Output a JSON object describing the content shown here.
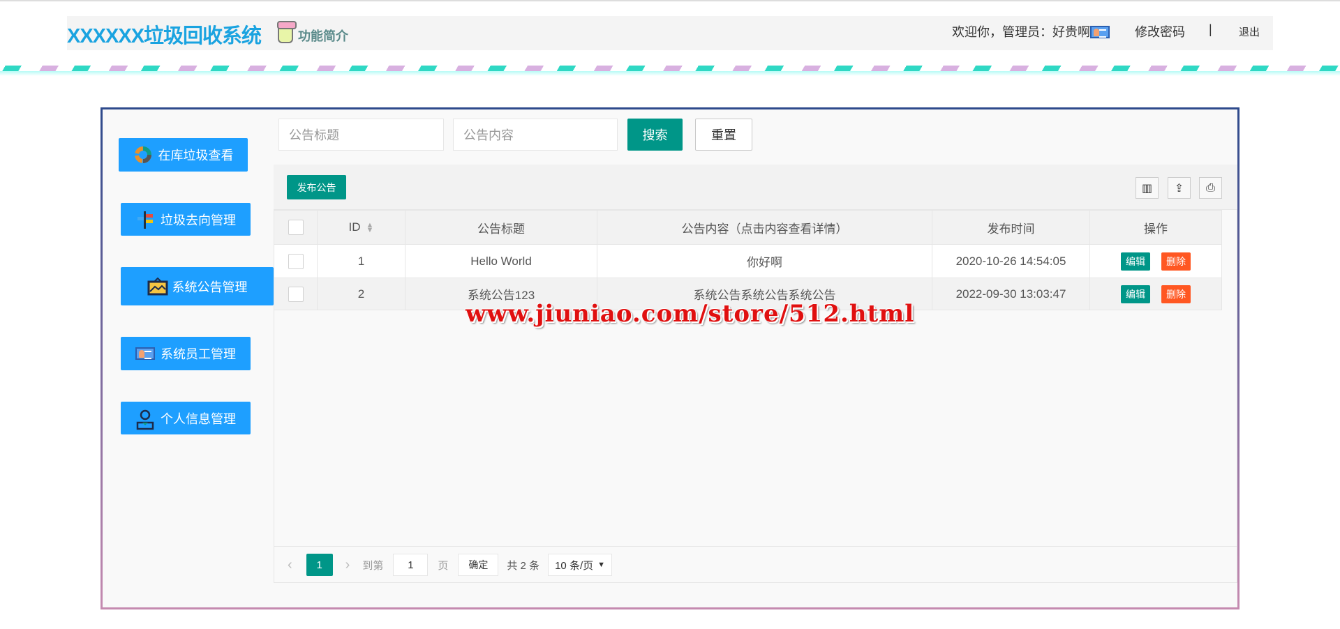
{
  "header": {
    "title": "XXXXXX垃圾回收系统",
    "intro": "功能简介",
    "welcome": "欢迎你，管理员：好贵啊",
    "change_password": "修改密码",
    "separator": "|",
    "logout": "退出"
  },
  "sidebar": {
    "items": [
      {
        "label": "在库垃圾查看",
        "icon": "recycle-icon"
      },
      {
        "label": "垃圾去向管理",
        "icon": "signpost-icon"
      },
      {
        "label": "系统公告管理",
        "icon": "notice-board-icon"
      },
      {
        "label": "系统员工管理",
        "icon": "id-card-icon"
      },
      {
        "label": "个人信息管理",
        "icon": "user-icon"
      }
    ]
  },
  "search": {
    "title_placeholder": "公告标题",
    "content_placeholder": "公告内容",
    "search_label": "搜索",
    "reset_label": "重置"
  },
  "toolbar": {
    "publish_label": "发布公告",
    "icons": [
      "columns-icon",
      "export-icon",
      "print-icon"
    ]
  },
  "table": {
    "columns": [
      "ID",
      "公告标题",
      "公告内容（点击内容查看详情）",
      "发布时间",
      "操作"
    ],
    "rows": [
      {
        "id": "1",
        "title": "Hello World",
        "content": "你好啊",
        "time": "2020-10-26 14:54:05"
      },
      {
        "id": "2",
        "title": "系统公告123",
        "content": "系统公告系统公告系统公告",
        "time": "2022-09-30 13:03:47"
      }
    ],
    "edit_label": "编辑",
    "delete_label": "删除"
  },
  "pagination": {
    "current": "1",
    "goto_label": "到第",
    "goto_value": "1",
    "page_unit": "页",
    "confirm_label": "确定",
    "total": "共 2 条",
    "page_size": "10 条/页"
  },
  "watermark": "www.jiuniao.com/store/512.html",
  "colors": {
    "primary": "#1e9fff",
    "teal": "#009688",
    "danger": "#ff5722",
    "title": "#1aa3e0"
  }
}
